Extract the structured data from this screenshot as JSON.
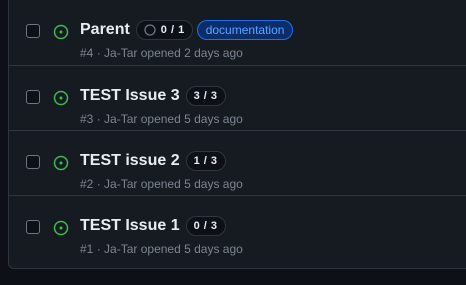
{
  "issues": [
    {
      "title": "Parent",
      "progress": "0 / 1",
      "progress_fraction": 0,
      "label": "documentation",
      "label_color": "#58a6ff",
      "number": "#4",
      "separator": "·",
      "author": "Ja-Tar",
      "opened_text": "opened 2 days ago"
    },
    {
      "title": "TEST Issue 3",
      "progress": "3 / 3",
      "progress_fraction": 1,
      "number": "#3",
      "separator": "·",
      "author": "Ja-Tar",
      "opened_text": "opened 5 days ago"
    },
    {
      "title": "TEST issue 2",
      "progress": "1 / 3",
      "progress_fraction": 0.33,
      "number": "#2",
      "separator": "·",
      "author": "Ja-Tar",
      "opened_text": "opened 5 days ago"
    },
    {
      "title": "TEST Issue 1",
      "progress": "0 / 3",
      "progress_fraction": 0,
      "number": "#1",
      "separator": "·",
      "author": "Ja-Tar",
      "opened_text": "opened 5 days ago"
    }
  ],
  "colors": {
    "open_icon": "#3fb950",
    "background": "#0d1117",
    "panel": "#161b22",
    "border": "#30363d",
    "muted_text": "#7d8590",
    "title_text": "#e6edf3"
  },
  "icons": {
    "status": "issue-opened-icon",
    "progress": "progress-ring-icon"
  }
}
